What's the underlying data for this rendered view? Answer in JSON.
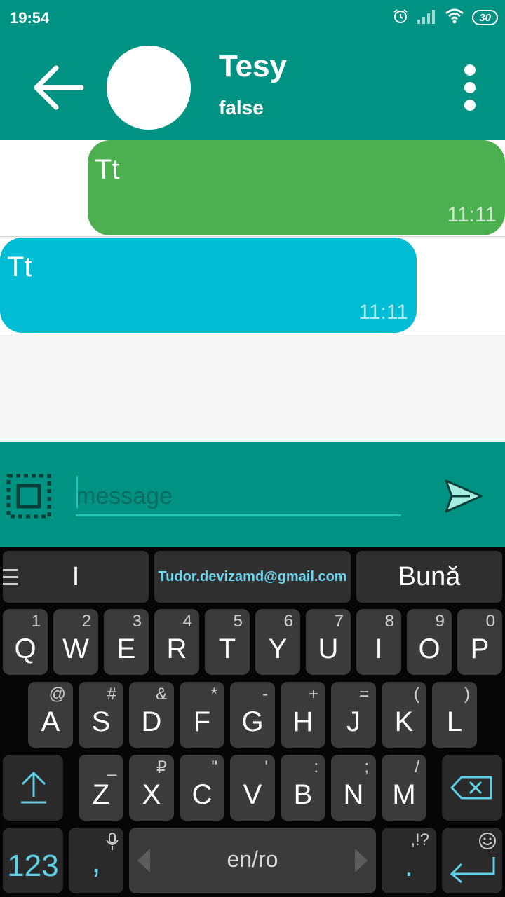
{
  "status_bar": {
    "time": "19:54",
    "battery": "30",
    "icons": [
      "alarm-icon",
      "signal-icon",
      "wifi-icon",
      "battery-icon"
    ]
  },
  "header": {
    "contact_name": "Tesy",
    "contact_status": "false",
    "color": "#009384"
  },
  "messages": [
    {
      "text": "Tt",
      "time": "11:11",
      "direction": "outgoing",
      "color": "#4caf50"
    },
    {
      "text": "Tt",
      "time": "11:11",
      "direction": "incoming",
      "color": "#00bcd4"
    }
  ],
  "composer": {
    "placeholder": "message",
    "value": ""
  },
  "keyboard": {
    "suggestions": [
      "I",
      "Tudor.devizamd@gmail.com",
      "Bună"
    ],
    "row1": [
      {
        "key": "Q",
        "hint": "1"
      },
      {
        "key": "W",
        "hint": "2"
      },
      {
        "key": "E",
        "hint": "3"
      },
      {
        "key": "R",
        "hint": "4"
      },
      {
        "key": "T",
        "hint": "5"
      },
      {
        "key": "Y",
        "hint": "6"
      },
      {
        "key": "U",
        "hint": "7"
      },
      {
        "key": "I",
        "hint": "8"
      },
      {
        "key": "O",
        "hint": "9"
      },
      {
        "key": "P",
        "hint": "0"
      }
    ],
    "row2": [
      {
        "key": "A",
        "hint": "@"
      },
      {
        "key": "S",
        "hint": "#"
      },
      {
        "key": "D",
        "hint": "&"
      },
      {
        "key": "F",
        "hint": "*"
      },
      {
        "key": "G",
        "hint": "-"
      },
      {
        "key": "H",
        "hint": "+"
      },
      {
        "key": "J",
        "hint": "="
      },
      {
        "key": "K",
        "hint": "("
      },
      {
        "key": "L",
        "hint": ")"
      }
    ],
    "row3": [
      {
        "key": "Z",
        "hint": "_"
      },
      {
        "key": "X",
        "hint": "₽"
      },
      {
        "key": "C",
        "hint": "\""
      },
      {
        "key": "V",
        "hint": "'"
      },
      {
        "key": "B",
        "hint": ":"
      },
      {
        "key": "N",
        "hint": ";"
      },
      {
        "key": "M",
        "hint": "/"
      }
    ],
    "symbols_key": "123",
    "comma_key": ",",
    "space_label": "en/ro",
    "period_key": ".",
    "period_hint": ",!?",
    "accent_color": "#5fd0e6"
  }
}
